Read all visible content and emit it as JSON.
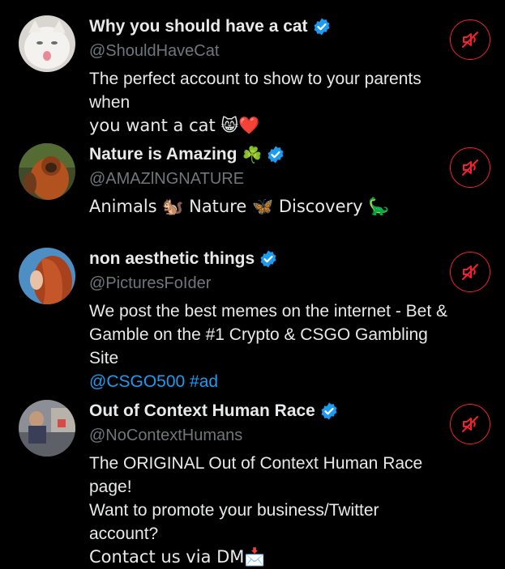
{
  "accounts": [
    {
      "name": "Why you should have a cat",
      "extra": "",
      "handle": "@ShouldHaveCat",
      "bio_lines": [
        "The perfect account to show to your parents when",
        "you want a cat 😸❤️"
      ],
      "verified": true,
      "avatar": "white-cat-avatar"
    },
    {
      "name": "Nature is Amazing",
      "extra": "☘️",
      "handle": "@AMAZlNGNATURE",
      "bio_lines": [
        "Animals 🐿️ Nature 🦋 Discovery 🦕"
      ],
      "verified": true,
      "avatar": "orangutan-avatar"
    },
    {
      "name": "non aesthetic things",
      "extra": "",
      "handle": "@PicturesFoIder",
      "bio_lines": [
        "We post the best memes on the internet - Bet &",
        "Gamble on the #1 Crypto & CSGO Gambling Site"
      ],
      "bio_link_line": "@CSGO500 #ad",
      "verified": true,
      "avatar": "red-hair-avatar"
    },
    {
      "name": "Out of Context Human Race",
      "extra": "",
      "handle": "@NoContextHumans",
      "bio_lines": [
        "The ORIGINAL Out of Context Human Race page!",
        "Want to promote your business/Twitter account?",
        "Contact us via DM📩"
      ],
      "verified": true,
      "avatar": "street-photo-avatar"
    }
  ],
  "icons": {
    "mute": "speaker-muted-icon",
    "verified": "verified-badge-icon"
  },
  "colors": {
    "background": "#000000",
    "text": "#e7e9ea",
    "secondary": "#71767b",
    "link": "#1d9bf0",
    "mute_red": "#f4212e",
    "verified": "#1d9bf0"
  }
}
